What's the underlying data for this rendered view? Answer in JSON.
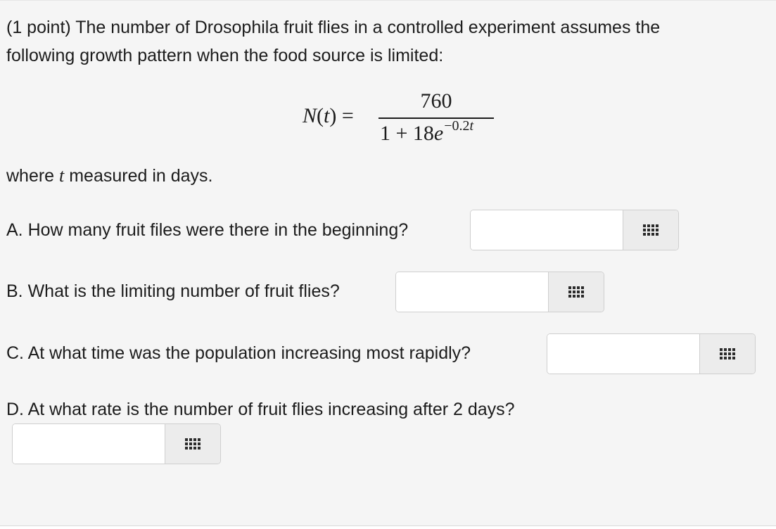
{
  "intro": {
    "line1": "(1 point) The number of Drosophila fruit flies in a controlled experiment assumes the",
    "line2": "following growth pattern when the food source is limited:"
  },
  "formula": {
    "lhs_function": "N",
    "lhs_var": "t",
    "equals": "=",
    "numerator": "760",
    "denominator_base": "1 + 18",
    "denominator_e": "e",
    "exponent": "−0.2",
    "exponent_var": "t"
  },
  "units_note": {
    "prefix": "where",
    "variable": "t",
    "suffix": "measured in days."
  },
  "questions": [
    {
      "label": "A. How many fruit files were there in the beginning?",
      "value": "",
      "palette_icon": "grid-icon"
    },
    {
      "label": "B. What is the limiting number of fruit flies?",
      "value": "",
      "palette_icon": "grid-icon"
    },
    {
      "label": "C. At what time was the population increasing most rapidly?",
      "value": "",
      "palette_icon": "grid-icon"
    },
    {
      "label": "D. At what rate is the number of fruit flies increasing after 2 days?",
      "value": "",
      "palette_icon": "grid-icon"
    }
  ]
}
